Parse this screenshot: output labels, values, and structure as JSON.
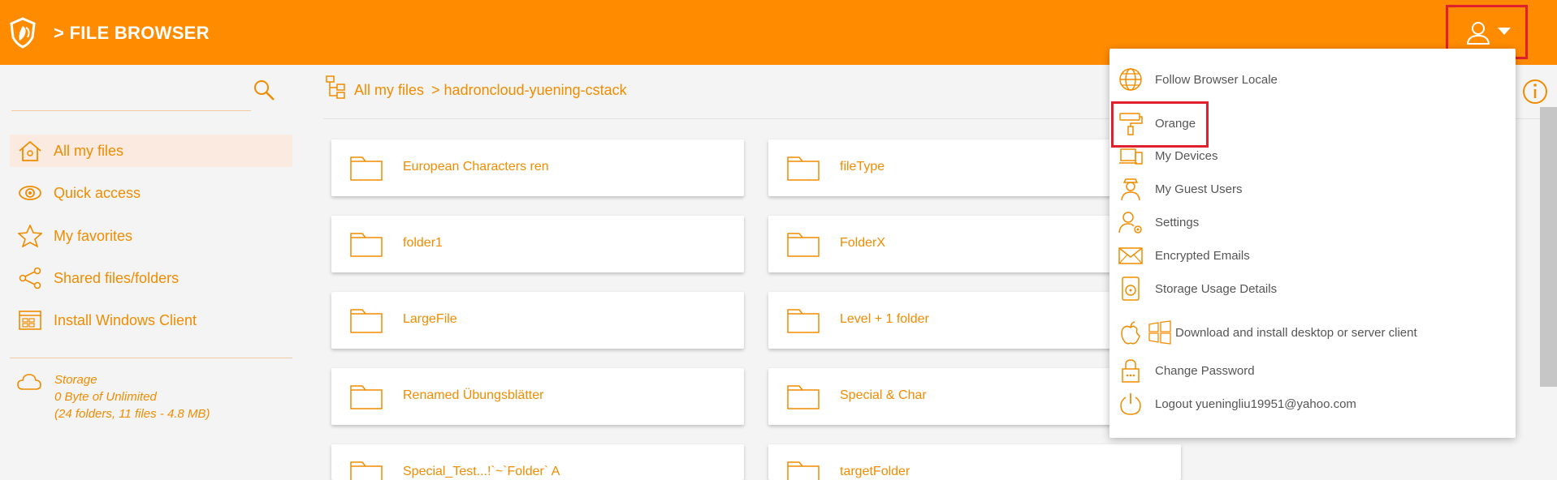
{
  "header": {
    "title": "> FILE BROWSER",
    "logo_icon": "shield-flower-logo",
    "user_icon": "user-avatar-icon"
  },
  "sidebar": {
    "search_icon": "search-icon",
    "items": [
      {
        "label": "All my files",
        "icon": "home-icon",
        "active": true
      },
      {
        "label": "Quick access",
        "icon": "eye-icon",
        "active": false
      },
      {
        "label": "My favorites",
        "icon": "star-icon",
        "active": false
      },
      {
        "label": "Shared files/folders",
        "icon": "share-icon",
        "active": false
      },
      {
        "label": "Install Windows Client",
        "icon": "windows-client-icon",
        "active": false
      }
    ],
    "storage": {
      "title": "Storage",
      "usage": "0 Byte of Unlimited",
      "detail": "(24 folders, 11 files - 4.8 MB)"
    }
  },
  "breadcrumb": {
    "root": "All my files",
    "current": "> hadroncloud-yuening-cstack"
  },
  "folders": [
    "European Characters ren",
    "fileType",
    "folder1",
    "FolderX",
    "LargeFile",
    "Level + 1 folder",
    "Renamed Übungsblätter",
    "Special & Char",
    "Special_Test...!`~`Folder` A",
    "targetFolder"
  ],
  "menu": {
    "items": [
      {
        "label": "Follow Browser Locale",
        "icon": "globe-icon"
      },
      {
        "label": "Orange",
        "icon": "paint-roller-icon"
      },
      {
        "label": "My Devices",
        "icon": "devices-icon"
      },
      {
        "label": "My Guest Users",
        "icon": "guest-user-icon"
      },
      {
        "label": "Settings",
        "icon": "user-settings-icon"
      },
      {
        "label": "Encrypted Emails",
        "icon": "envelope-icon"
      },
      {
        "label": "Storage Usage Details",
        "icon": "disk-icon"
      },
      {
        "label": "Download and install desktop or server client",
        "icon": "apple-icon"
      },
      {
        "label": "Change Password",
        "icon": "lock-icon"
      },
      {
        "label": "Logout yueningliu19951@yahoo.com",
        "icon": "power-icon"
      }
    ]
  },
  "colors": {
    "brand": "#ff8c00",
    "accent_text": "#f08c00",
    "highlight": "#e0202f"
  }
}
